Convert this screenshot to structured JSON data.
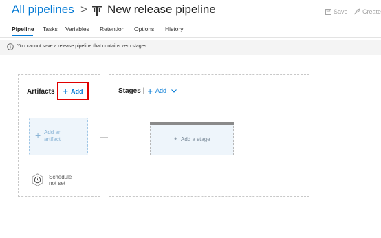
{
  "header": {
    "breadcrumb_root": "All pipelines",
    "separator": ">",
    "pipeline_icon": "release-pipeline-icon",
    "title": "New release pipeline",
    "save_label": "Save",
    "save_icon": "save-icon",
    "create_label": "Create rel",
    "create_icon": "rocket-icon"
  },
  "tabs": [
    {
      "label": "Pipeline",
      "active": true
    },
    {
      "label": "Tasks"
    },
    {
      "label": "Variables"
    },
    {
      "label": "Retention"
    },
    {
      "label": "Options"
    },
    {
      "label": "History"
    }
  ],
  "info_bar": {
    "icon": "info-icon",
    "text": "You cannot save a release pipeline that contains zero stages."
  },
  "artifacts": {
    "title": "Artifacts",
    "add_plus": "+",
    "add_label": "Add",
    "card_plus": "+",
    "card_label_line1": "Add an",
    "card_label_line2": "artifact",
    "schedule_icon": "clock-icon",
    "schedule_line1": "Schedule",
    "schedule_line2": "not set"
  },
  "stages": {
    "title": "Stages",
    "divider": "|",
    "add_plus": "+",
    "add_label": "Add",
    "chevron": "chevron-down-icon",
    "card_plus": "+",
    "card_label": "Add a stage"
  },
  "colors": {
    "accent": "#0078d4",
    "highlight_border": "#e00000",
    "info_background": "#f4f4f4",
    "card_background": "#eef5fb"
  }
}
